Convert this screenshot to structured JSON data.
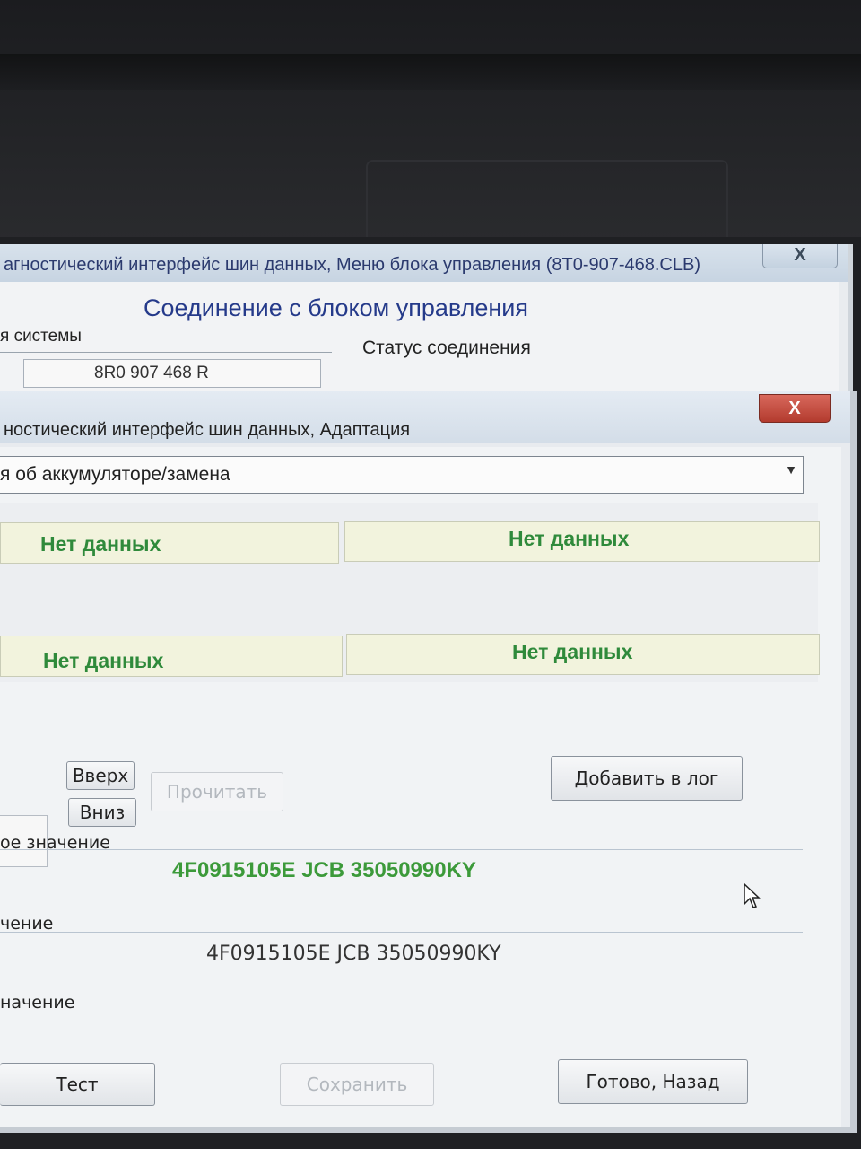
{
  "back_window": {
    "title": "агностический интерфейс шин данных,  Меню блока управления (8T0-907-468.CLB)",
    "close_label": "X",
    "heading": "Соединение с блоком управления",
    "left_label": "я системы",
    "status_label": "Статус соединения",
    "part_number": "8R0 907 468 R"
  },
  "front_window": {
    "title": "ностический интерфейс шин данных, Адаптация",
    "close_label": "X",
    "channel_select": {
      "value": "я об аккумуляторе/замена"
    },
    "grid": {
      "cells": [
        "Нет данных",
        "Нет данных",
        "Нет данных",
        "Нет данных"
      ]
    },
    "buttons": {
      "up": "Вверх",
      "down": "Вниз",
      "read": "Прочитать",
      "add_log": "Добавить в лог",
      "test": "Тест",
      "save": "Сохранить",
      "done": "Готово, Назад"
    },
    "stored_value": {
      "label": "ое значение",
      "value": "4F0915105E  JCB 35050990KY"
    },
    "new_value": {
      "label": "чение",
      "value": "4F0915105E  JCB 35050990KY"
    },
    "third_label": "начение"
  },
  "colors": {
    "green_text": "#2f8a3b",
    "close_red": "#c0392b",
    "title_blue": "#253a8a"
  }
}
